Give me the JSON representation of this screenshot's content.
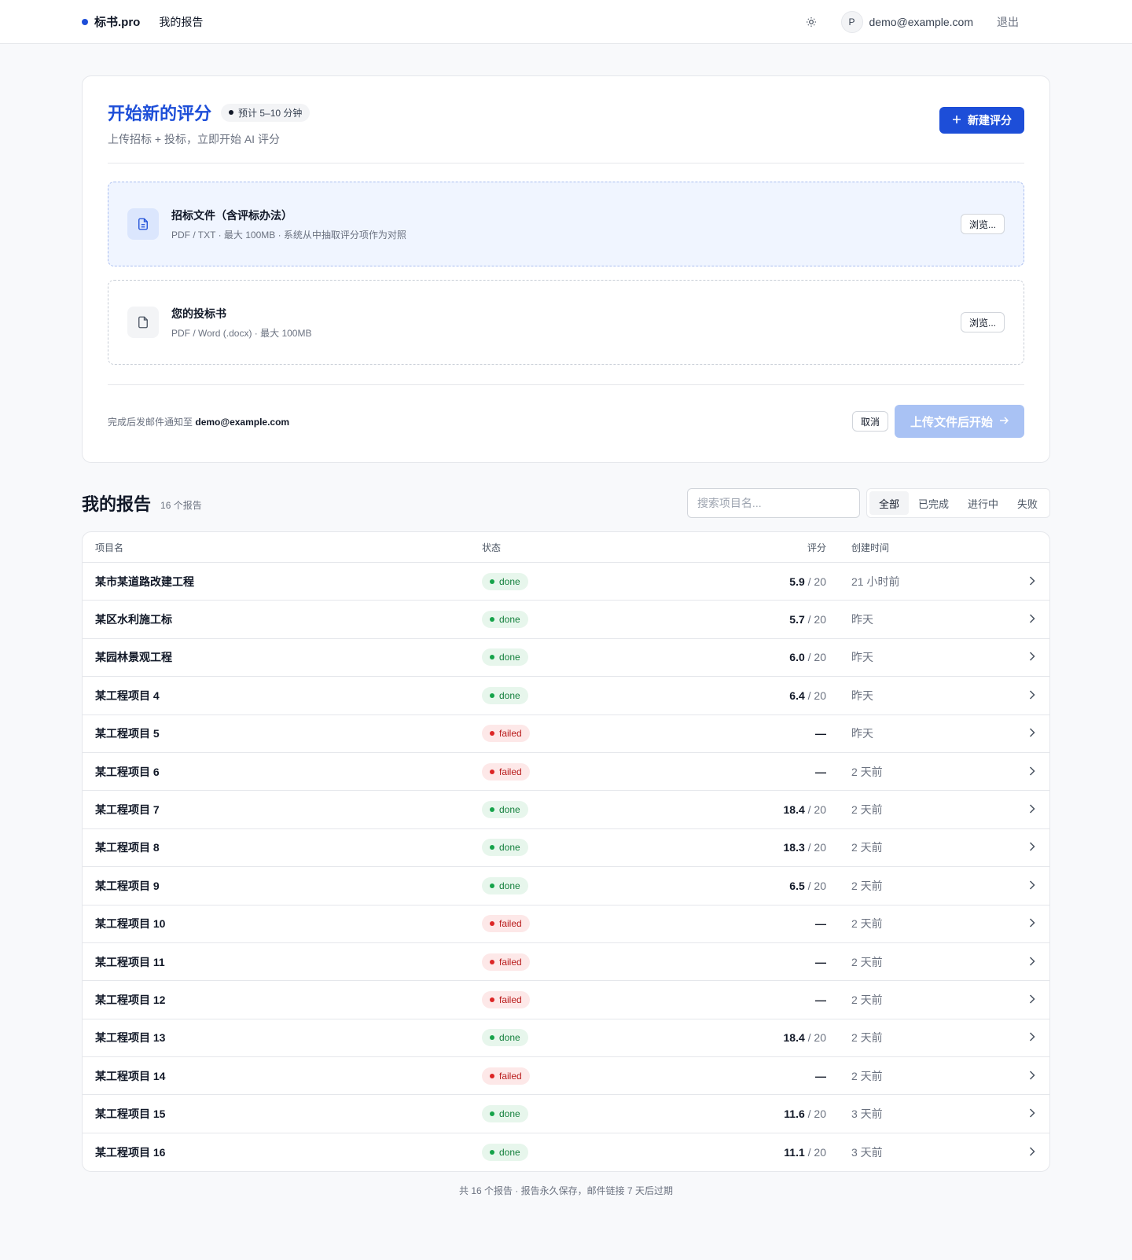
{
  "header": {
    "brand": "标书.pro",
    "nav_reports": "我的报告",
    "avatar_letter": "P",
    "user_email": "demo@example.com",
    "logout": "退出"
  },
  "upload": {
    "title": "开始新的评分",
    "eta": "预计 5–10 分钟",
    "subtitle": "上传招标 + 投标，立即开始 AI 评分",
    "new_button": "新建评分",
    "tender": {
      "title": "招标文件（含评标办法）",
      "hint": "PDF / TXT · 最大 100MB · 系统从中抽取评分项作为对照",
      "browse": "浏览..."
    },
    "bid": {
      "title": "您的投标书",
      "hint": "PDF / Word (.docx) · 最大 100MB",
      "browse": "浏览..."
    },
    "notify_prefix": "完成后发邮件通知至",
    "notify_email": "demo@example.com",
    "cancel": "取消",
    "start": "上传文件后开始"
  },
  "reports": {
    "title": "我的报告",
    "count": "16 个报告",
    "search_placeholder": "搜索项目名...",
    "filters": [
      "全部",
      "已完成",
      "进行中",
      "失败"
    ],
    "columns": {
      "name": "项目名",
      "status": "状态",
      "score": "评分",
      "created": "创建时间"
    },
    "rows": [
      {
        "name": "某市某道路改建工程",
        "status": "done",
        "score": "5.9",
        "max": "/ 20",
        "created": "21 小时前"
      },
      {
        "name": "某区水利施工标",
        "status": "done",
        "score": "5.7",
        "max": "/ 20",
        "created": "昨天"
      },
      {
        "name": "某园林景观工程",
        "status": "done",
        "score": "6.0",
        "max": "/ 20",
        "created": "昨天"
      },
      {
        "name": "某工程项目 4",
        "status": "done",
        "score": "6.4",
        "max": "/ 20",
        "created": "昨天"
      },
      {
        "name": "某工程项目 5",
        "status": "failed",
        "score": "—",
        "max": "",
        "created": "昨天"
      },
      {
        "name": "某工程项目 6",
        "status": "failed",
        "score": "—",
        "max": "",
        "created": "2 天前"
      },
      {
        "name": "某工程项目 7",
        "status": "done",
        "score": "18.4",
        "max": "/ 20",
        "created": "2 天前"
      },
      {
        "name": "某工程项目 8",
        "status": "done",
        "score": "18.3",
        "max": "/ 20",
        "created": "2 天前"
      },
      {
        "name": "某工程项目 9",
        "status": "done",
        "score": "6.5",
        "max": "/ 20",
        "created": "2 天前"
      },
      {
        "name": "某工程项目 10",
        "status": "failed",
        "score": "—",
        "max": "",
        "created": "2 天前"
      },
      {
        "name": "某工程项目 11",
        "status": "failed",
        "score": "—",
        "max": "",
        "created": "2 天前"
      },
      {
        "name": "某工程项目 12",
        "status": "failed",
        "score": "—",
        "max": "",
        "created": "2 天前"
      },
      {
        "name": "某工程项目 13",
        "status": "done",
        "score": "18.4",
        "max": "/ 20",
        "created": "2 天前"
      },
      {
        "name": "某工程项目 14",
        "status": "failed",
        "score": "—",
        "max": "",
        "created": "2 天前"
      },
      {
        "name": "某工程项目 15",
        "status": "done",
        "score": "11.6",
        "max": "/ 20",
        "created": "3 天前"
      },
      {
        "name": "某工程项目 16",
        "status": "done",
        "score": "11.1",
        "max": "/ 20",
        "created": "3 天前"
      }
    ],
    "footer": "共 16 个报告 · 报告永久保存，邮件链接 7 天后过期"
  },
  "colors": {
    "accent": "#1d4ed8",
    "done": "#16a34a",
    "failed": "#dc2626"
  }
}
